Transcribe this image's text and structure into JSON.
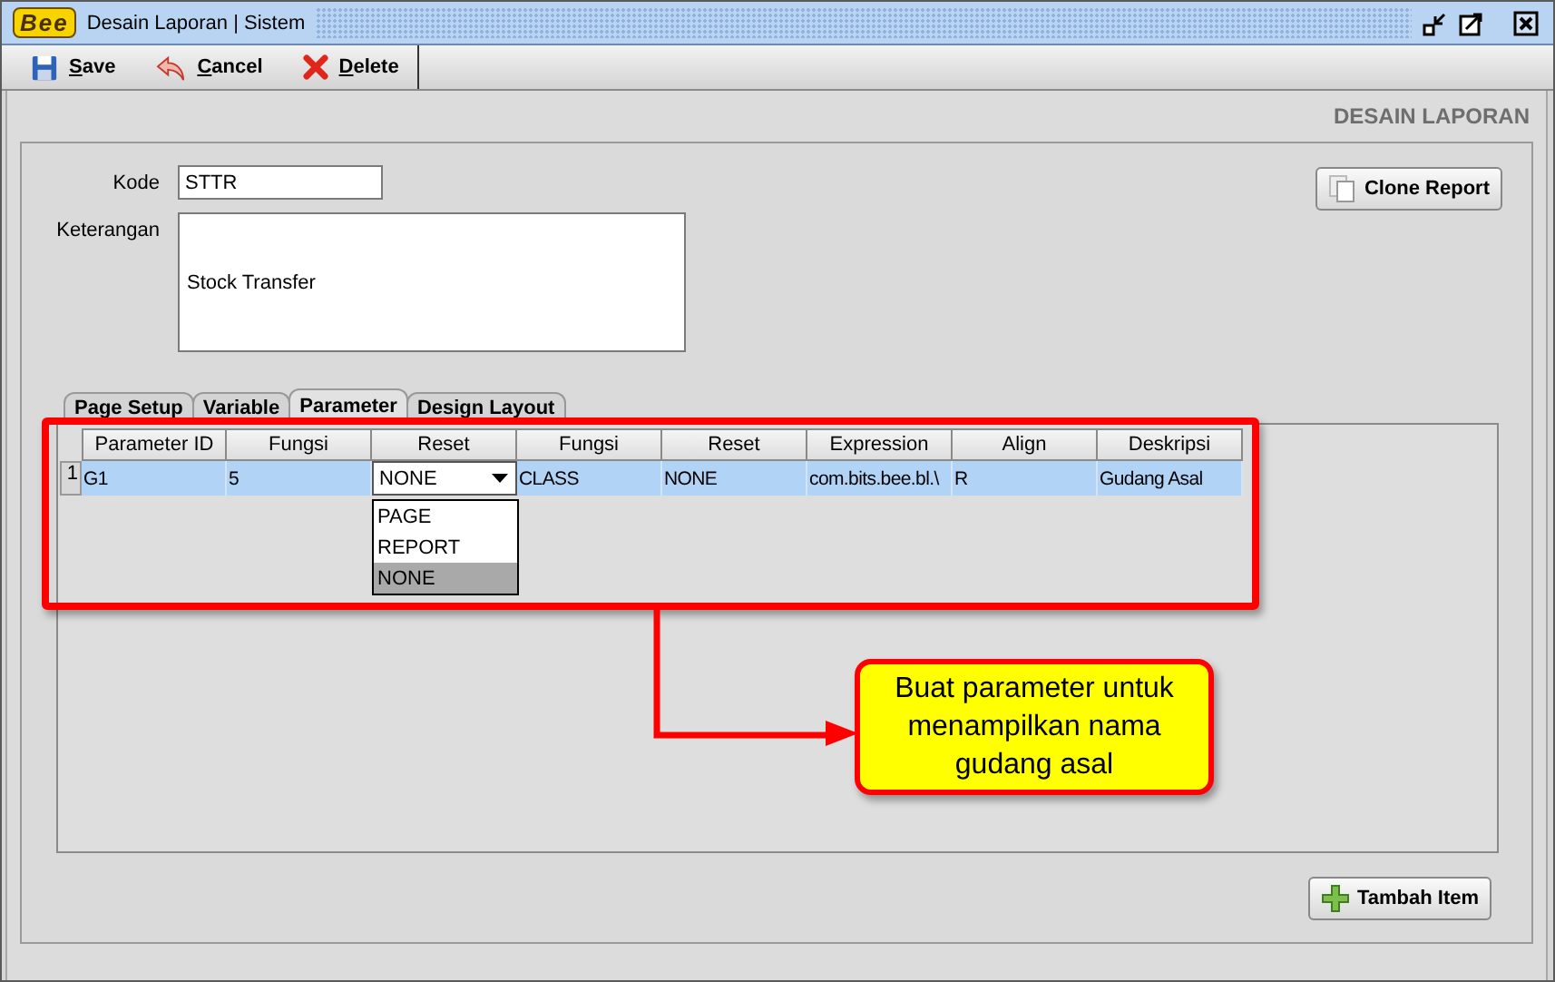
{
  "window": {
    "logo": "Bee",
    "title": "Desain Laporan | Sistem"
  },
  "toolbar": [
    {
      "label": "Save",
      "kind": "save"
    },
    {
      "label": "Cancel",
      "kind": "cancel"
    },
    {
      "label": "Delete",
      "kind": "delete"
    }
  ],
  "header": "DESAIN LAPORAN",
  "form": {
    "kode_label": "Kode",
    "kode_value": "STTR",
    "keterangan_label": "Keterangan",
    "keterangan_value": "Stock Transfer",
    "clone_button": "Clone Report"
  },
  "tabs": [
    {
      "label": "Page Setup",
      "selected": false
    },
    {
      "label": "Variable",
      "selected": false
    },
    {
      "label": "Parameter",
      "selected": true
    },
    {
      "label": "Design Layout",
      "selected": false
    }
  ],
  "table": {
    "columns": [
      "Parameter ID",
      "Fungsi",
      "Reset",
      "Fungsi",
      "Reset",
      "Expression",
      "Align",
      "Deskripsi"
    ],
    "rows": [
      {
        "number": "1",
        "selected": true,
        "cells": [
          {
            "kind": "text",
            "value": "G1"
          },
          {
            "kind": "text",
            "value": "5"
          },
          {
            "kind": "combo",
            "value": "NONE",
            "expanded": true,
            "options": [
              {
                "label": "PAGE",
                "selected": false
              },
              {
                "label": "REPORT",
                "selected": false
              },
              {
                "label": "NONE",
                "selected": true
              }
            ]
          },
          {
            "kind": "text",
            "value": "CLASS"
          },
          {
            "kind": "text",
            "value": "NONE"
          },
          {
            "kind": "text",
            "value": "com.bits.bee.bl.\\"
          },
          {
            "kind": "text",
            "value": "R"
          },
          {
            "kind": "text",
            "value": "Gudang Asal"
          }
        ]
      }
    ]
  },
  "callout": {
    "lines": [
      "Buat parameter untuk",
      "menampilkan nama",
      "gudang asal"
    ]
  },
  "add_button": "Tambah Item"
}
